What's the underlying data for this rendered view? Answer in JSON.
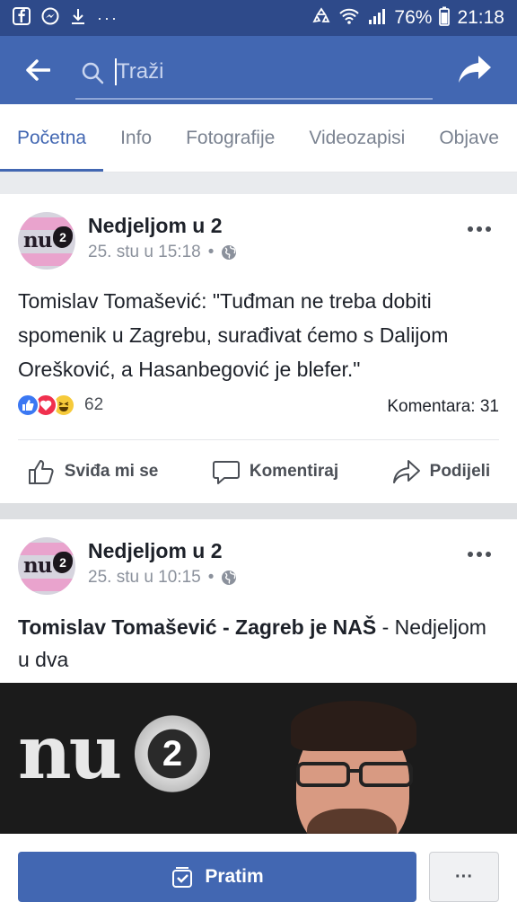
{
  "status_bar": {
    "battery": "76%",
    "time": "21:18",
    "icons": [
      "fb-icon",
      "messenger-icon",
      "download-icon",
      "more-dots-icon",
      "recycle-icon",
      "wifi-icon",
      "signal-icon"
    ]
  },
  "app_bar": {
    "search_placeholder": "Traži",
    "colors": {
      "bar": "#4267b2",
      "status": "#2e4a8a"
    }
  },
  "tabs": [
    {
      "label": "Početna",
      "active": true
    },
    {
      "label": "Info"
    },
    {
      "label": "Fotografije"
    },
    {
      "label": "Videozapisi"
    },
    {
      "label": "Objave"
    }
  ],
  "posts": [
    {
      "page_name": "Nedjeljom u 2",
      "timestamp": "25. stu u 15:18",
      "separator": "•",
      "text": "Tomislav Tomašević: \"Tuđman ne treba dobiti spomenik u Zagrebu, surađivat ćemo s Dalijom Orešković, a Hasanbegović je blefer.\"",
      "reaction_count": "62",
      "comments": "Komentara: 31",
      "actions": {
        "like": "Sviđa mi se",
        "comment": "Komentiraj",
        "share": "Podijeli"
      }
    },
    {
      "page_name": "Nedjeljom u 2",
      "timestamp": "25. stu u 10:15",
      "separator": "•",
      "headline_bold": "Tomislav Tomašević - Zagreb je NAŠ",
      "headline_rest": " - Nedjeljom u dva",
      "image_logo": "nu",
      "image_logo_number": "2"
    }
  ],
  "avatar_logo": {
    "text": "nu",
    "number": "2"
  },
  "footer": {
    "follow_label": "Pratim",
    "more_label": "···"
  }
}
